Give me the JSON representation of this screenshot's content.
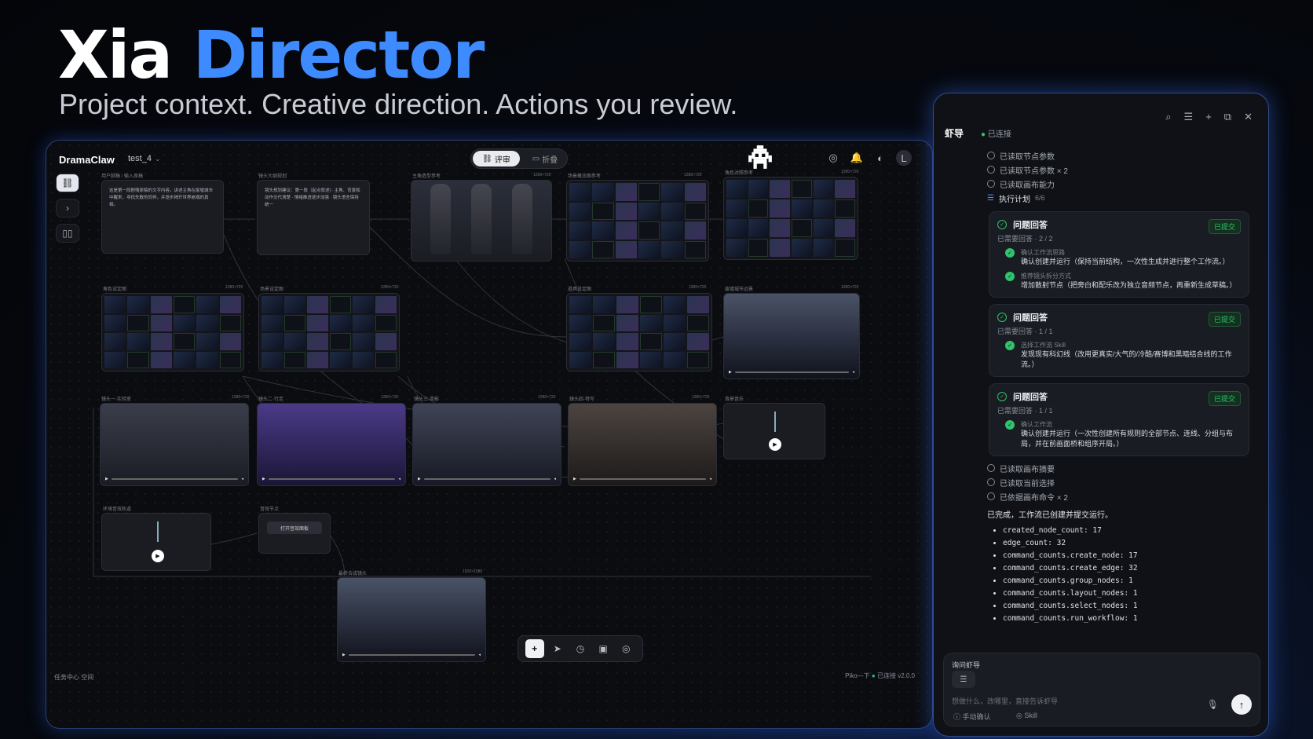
{
  "hero": {
    "title_a": "Xia ",
    "title_b": "Director",
    "subtitle": "Project context. Creative direction. Actions you review."
  },
  "app": {
    "logo": "DramaClaw",
    "project": "test_4",
    "toggle": {
      "active": "评审",
      "inactive": "折叠"
    },
    "status_left": "任务中心   空间",
    "status_right_model": "Piko—下",
    "status_right_conn": "已连接",
    "version": "v2.0.0",
    "nodes": [
      {
        "label": "用户脚稿 / 输入原稿",
        "text": "这是第一段剧情原稿的文字内容，讲述主角在废墟城市中醒来，寻找失散的同伴，并逐步揭开世界崩塌的真相。"
      },
      {
        "label": "镜头大纲规划",
        "text": "镜头规划建议：第一段（起点叙述）· 主角、背景和动作交代清楚 · 情绪推进逐步加强 · 镜头语言保持统一"
      },
      {
        "label": "主角造型参考",
        "dim": "1280×720"
      },
      {
        "label": "场景概念图参考",
        "dim": "1280×720"
      },
      {
        "label": "角色对照参考",
        "dim": "1280×720"
      },
      {
        "label": "角色设定图",
        "dim": "1280×720"
      },
      {
        "label": "场景设定图",
        "dim": "1280×720"
      },
      {
        "label": "道具设定图",
        "dim": "1280×720"
      },
      {
        "label": "废墟城市远景",
        "dim": "1280×720"
      },
      {
        "label": "镜头一·实验室",
        "dim": "1280×720"
      },
      {
        "label": "镜头二·行走",
        "dim": "1280×720"
      },
      {
        "label": "镜头三·背影",
        "dim": "1280×720"
      },
      {
        "label": "镜头四·特写",
        "dim": "1280×720"
      },
      {
        "label": "背景音乐"
      },
      {
        "label": "环境音效轨道"
      },
      {
        "label": "音效节点",
        "btn": "打开音效面板"
      },
      {
        "label": "最终合成镜头",
        "dim": "1920×1080"
      }
    ]
  },
  "panel": {
    "title": "虾导",
    "conn": "已连接",
    "steps_top": [
      "已读取节点参数",
      "已读取节点参数 × 2",
      "已读取画布能力"
    ],
    "plan": {
      "label": "执行计划",
      "count": "6/6"
    },
    "cards": [
      {
        "title": "问题回答",
        "badge": "已提交",
        "sub": "已需要回答 · 2 / 2",
        "qa": [
          {
            "q": "确认工作流思路",
            "a": "确认创建并运行（保持当前结构，一次性生成并进行整个工作流。）"
          },
          {
            "q": "推荐镜头拆分方式",
            "a": "增加散射节点（把旁白和配乐改为独立音频节点，再重新生成草稿。）"
          }
        ]
      },
      {
        "title": "问题回答",
        "badge": "已提交",
        "sub": "已需要回答 · 1 / 1",
        "qa": [
          {
            "q": "选择工作流 Skill",
            "a": "发现现有科幻线（改用更真实/大气的/冷酷/赛博和黑暗结合线的工作流。）"
          }
        ]
      },
      {
        "title": "问题回答",
        "badge": "已提交",
        "sub": "已需要回答 · 1 / 1",
        "qa": [
          {
            "q": "确认工作流",
            "a": "确认创建并运行（一次性创建所有规则的全部节点、连线、分组与布局，并在前画面桥和组序开局。）"
          }
        ]
      }
    ],
    "steps_bottom": [
      "已读取画布摘要",
      "已读取当前选择",
      "已依据画布命令 × 2"
    ],
    "done": "已完成，工作流已创建并提交运行。",
    "stats": [
      "created_node_count: 17",
      "edge_count: 32",
      "command_counts.create_node: 17",
      "command_counts.create_edge: 32",
      "command_counts.group_nodes: 1",
      "command_counts.layout_nodes: 1",
      "command_counts.select_nodes: 1",
      "command_counts.run_workflow: 1"
    ],
    "input": {
      "label": "询问虾导",
      "placeholder": "想做什么，改哪里，直接告诉虾导",
      "mode1": "手动确认",
      "mode2": "Skill"
    }
  }
}
